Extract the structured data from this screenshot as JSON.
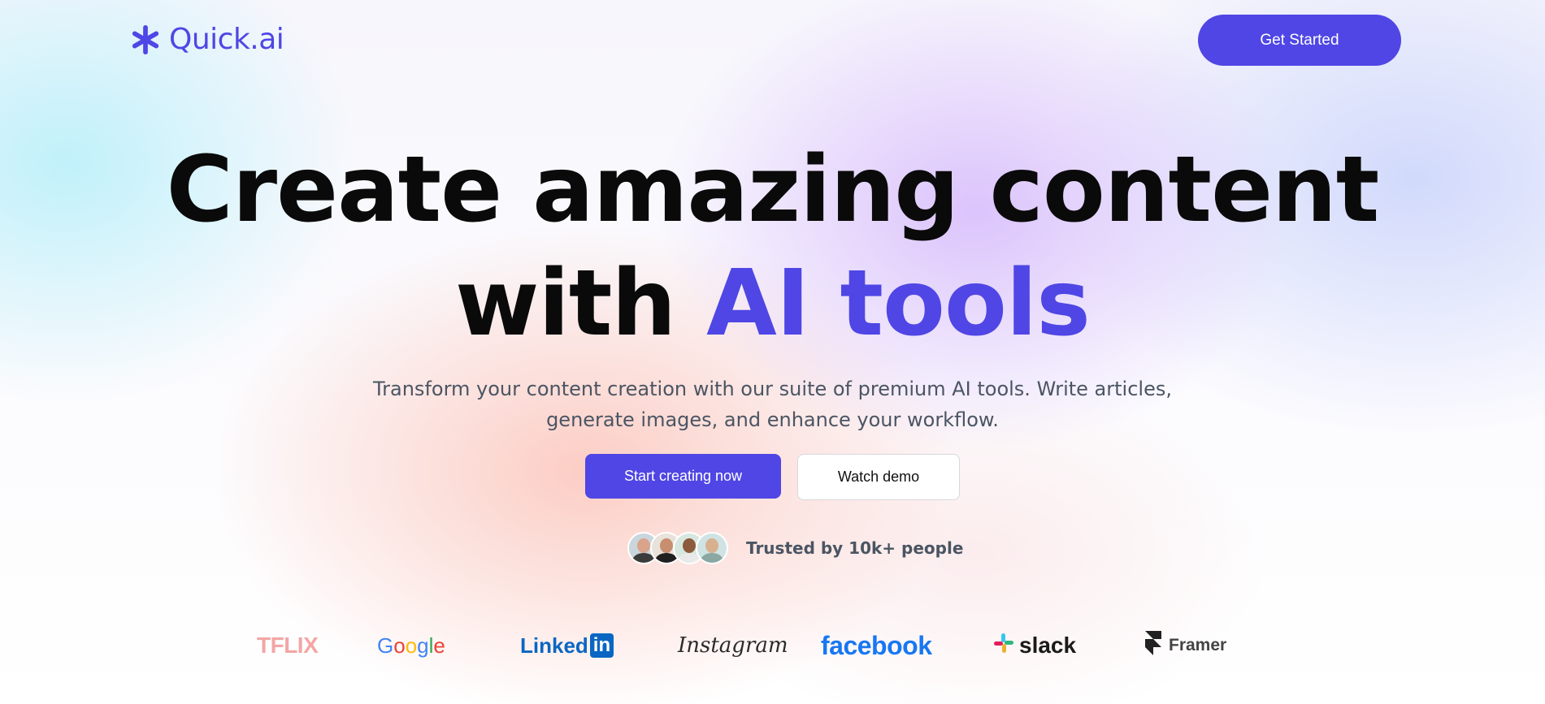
{
  "brand": {
    "name": "Quick.ai",
    "icon": "asterisk-icon",
    "accent": "#4f46e5"
  },
  "nav": {
    "cta_label": "Get Started"
  },
  "hero": {
    "headline_line1": "Create amazing content",
    "headline_line2_prefix": "with ",
    "headline_line2_accent": "AI tools",
    "subtitle_line1": "Transform your content creation with our suite of premium AI tools. Write articles,",
    "subtitle_line2": "generate images, and enhance your workflow.",
    "primary_cta": "Start creating now",
    "secondary_cta": "Watch demo",
    "trust_text": "Trusted by 10k+ people"
  },
  "logos": {
    "netflix": "TFLIX",
    "google": [
      "G",
      "o",
      "o",
      "g",
      "l",
      "e"
    ],
    "linkedin_text": "Linked",
    "linkedin_badge": "in",
    "instagram": "Instagram",
    "facebook": "facebook",
    "slack": "slack",
    "framer": "Framer"
  },
  "colors": {
    "primary": "#4f46e5",
    "text_dark": "#0a0a0a",
    "text_muted": "#4b5563"
  }
}
